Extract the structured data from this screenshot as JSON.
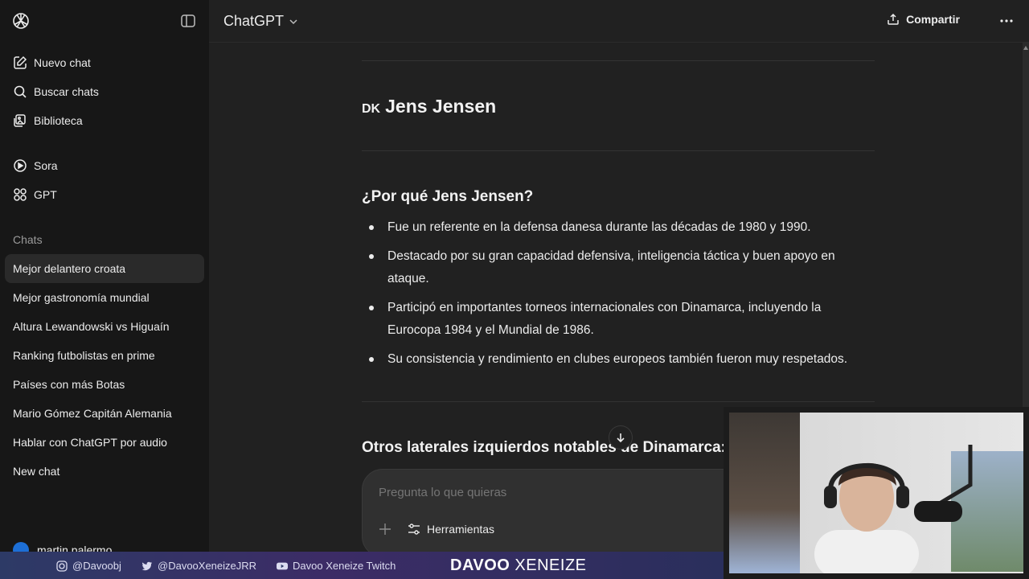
{
  "sidebar": {
    "items": [
      {
        "label": "Nuevo chat",
        "icon": "new-chat-icon"
      },
      {
        "label": "Buscar chats",
        "icon": "search-icon"
      },
      {
        "label": "Biblioteca",
        "icon": "library-icon"
      },
      {
        "label": "Sora",
        "icon": "sora-icon"
      },
      {
        "label": "GPT",
        "icon": "gpt-grid-icon"
      }
    ],
    "section_label": "Chats",
    "chats": [
      "Mejor delantero croata",
      "Mejor gastronomía mundial",
      "Altura Lewandowski vs Higuaín",
      "Ranking futbolistas en prime",
      "Países con más Botas",
      "Mario Gómez Capitán Alemania",
      "Hablar con ChatGPT por audio",
      "New chat"
    ],
    "user_name": "martin palermo"
  },
  "header": {
    "model": "ChatGPT",
    "share_label": "Compartir"
  },
  "content": {
    "flag": "DK",
    "player_heading": "Jens Jensen",
    "why_heading": "¿Por qué Jens Jensen?",
    "bullets": [
      "Fue un referente en la defensa danesa durante las décadas de 1980 y 1990.",
      "Destacado por su gran capacidad defensiva, inteligencia táctica y buen apoyo en ataque.",
      "Participó en importantes torneos internacionales con Dinamarca, incluyendo la Eurocopa 1984 y el Mundial de 1986.",
      "Su consistencia y rendimiento en clubes europeos también fueron muy respetados."
    ],
    "next_heading": "Otros laterales izquierdos notables de Dinamarca:"
  },
  "composer": {
    "placeholder": "Pregunta lo que quieras",
    "tools_label": "Herramientas"
  },
  "stream_overlay": {
    "instagram": "@Davoobj",
    "twitter": "@DavooXeneizeJRR",
    "youtube": "Davoo Xeneize Twitch",
    "brand_a": "DAVOO",
    "brand_b": "XENEIZE"
  },
  "colors": {
    "background": "#212121",
    "sidebar": "#171717",
    "composer": "#303030",
    "avatar": "#1d6fd6"
  }
}
